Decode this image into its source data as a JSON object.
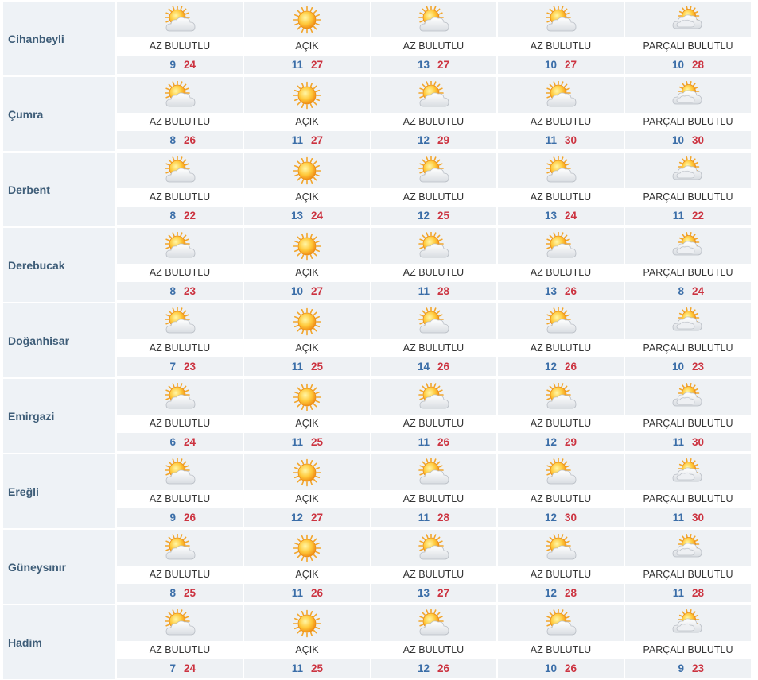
{
  "colors": {
    "city_bg": "#eef2f6",
    "city_text": "#3e5d78",
    "min_temp": "#3b6ea8",
    "max_temp": "#cc3340",
    "strip_bg": "#eef1f4"
  },
  "conditions": {
    "AZ BULUTLU": "partly-sunny-icon",
    "AÇIK": "sun-icon",
    "PARÇALI BULUTLU": "cloudy-sun-icon"
  },
  "rows": [
    {
      "city": "Cihanbeyli",
      "days": [
        {
          "cond": "AZ BULUTLU",
          "min": "9",
          "max": "24"
        },
        {
          "cond": "AÇIK",
          "min": "11",
          "max": "27"
        },
        {
          "cond": "AZ BULUTLU",
          "min": "13",
          "max": "27"
        },
        {
          "cond": "AZ BULUTLU",
          "min": "10",
          "max": "27"
        },
        {
          "cond": "PARÇALI BULUTLU",
          "min": "10",
          "max": "28"
        }
      ]
    },
    {
      "city": "Çumra",
      "days": [
        {
          "cond": "AZ BULUTLU",
          "min": "8",
          "max": "26"
        },
        {
          "cond": "AÇIK",
          "min": "11",
          "max": "27"
        },
        {
          "cond": "AZ BULUTLU",
          "min": "12",
          "max": "29"
        },
        {
          "cond": "AZ BULUTLU",
          "min": "11",
          "max": "30"
        },
        {
          "cond": "PARÇALI BULUTLU",
          "min": "10",
          "max": "30"
        }
      ]
    },
    {
      "city": "Derbent",
      "days": [
        {
          "cond": "AZ BULUTLU",
          "min": "8",
          "max": "22"
        },
        {
          "cond": "AÇIK",
          "min": "13",
          "max": "24"
        },
        {
          "cond": "AZ BULUTLU",
          "min": "12",
          "max": "25"
        },
        {
          "cond": "AZ BULUTLU",
          "min": "13",
          "max": "24"
        },
        {
          "cond": "PARÇALI BULUTLU",
          "min": "11",
          "max": "22"
        }
      ]
    },
    {
      "city": "Derebucak",
      "days": [
        {
          "cond": "AZ BULUTLU",
          "min": "8",
          "max": "23"
        },
        {
          "cond": "AÇIK",
          "min": "10",
          "max": "27"
        },
        {
          "cond": "AZ BULUTLU",
          "min": "11",
          "max": "28"
        },
        {
          "cond": "AZ BULUTLU",
          "min": "13",
          "max": "26"
        },
        {
          "cond": "PARÇALI BULUTLU",
          "min": "8",
          "max": "24"
        }
      ]
    },
    {
      "city": "Doğanhisar",
      "days": [
        {
          "cond": "AZ BULUTLU",
          "min": "7",
          "max": "23"
        },
        {
          "cond": "AÇIK",
          "min": "11",
          "max": "25"
        },
        {
          "cond": "AZ BULUTLU",
          "min": "14",
          "max": "26"
        },
        {
          "cond": "AZ BULUTLU",
          "min": "12",
          "max": "26"
        },
        {
          "cond": "PARÇALI BULUTLU",
          "min": "10",
          "max": "23"
        }
      ]
    },
    {
      "city": "Emirgazi",
      "days": [
        {
          "cond": "AZ BULUTLU",
          "min": "6",
          "max": "24"
        },
        {
          "cond": "AÇIK",
          "min": "11",
          "max": "25"
        },
        {
          "cond": "AZ BULUTLU",
          "min": "11",
          "max": "26"
        },
        {
          "cond": "AZ BULUTLU",
          "min": "12",
          "max": "29"
        },
        {
          "cond": "PARÇALI BULUTLU",
          "min": "11",
          "max": "30"
        }
      ]
    },
    {
      "city": "Ereğli",
      "days": [
        {
          "cond": "AZ BULUTLU",
          "min": "9",
          "max": "26"
        },
        {
          "cond": "AÇIK",
          "min": "12",
          "max": "27"
        },
        {
          "cond": "AZ BULUTLU",
          "min": "11",
          "max": "28"
        },
        {
          "cond": "AZ BULUTLU",
          "min": "12",
          "max": "30"
        },
        {
          "cond": "PARÇALI BULUTLU",
          "min": "11",
          "max": "30"
        }
      ]
    },
    {
      "city": "Güneysınır",
      "days": [
        {
          "cond": "AZ BULUTLU",
          "min": "8",
          "max": "25"
        },
        {
          "cond": "AÇIK",
          "min": "11",
          "max": "26"
        },
        {
          "cond": "AZ BULUTLU",
          "min": "13",
          "max": "27"
        },
        {
          "cond": "AZ BULUTLU",
          "min": "12",
          "max": "28"
        },
        {
          "cond": "PARÇALI BULUTLU",
          "min": "11",
          "max": "28"
        }
      ]
    },
    {
      "city": "Hadim",
      "days": [
        {
          "cond": "AZ BULUTLU",
          "min": "7",
          "max": "24"
        },
        {
          "cond": "AÇIK",
          "min": "11",
          "max": "25"
        },
        {
          "cond": "AZ BULUTLU",
          "min": "12",
          "max": "26"
        },
        {
          "cond": "AZ BULUTLU",
          "min": "10",
          "max": "26"
        },
        {
          "cond": "PARÇALI BULUTLU",
          "min": "9",
          "max": "23"
        }
      ]
    }
  ]
}
